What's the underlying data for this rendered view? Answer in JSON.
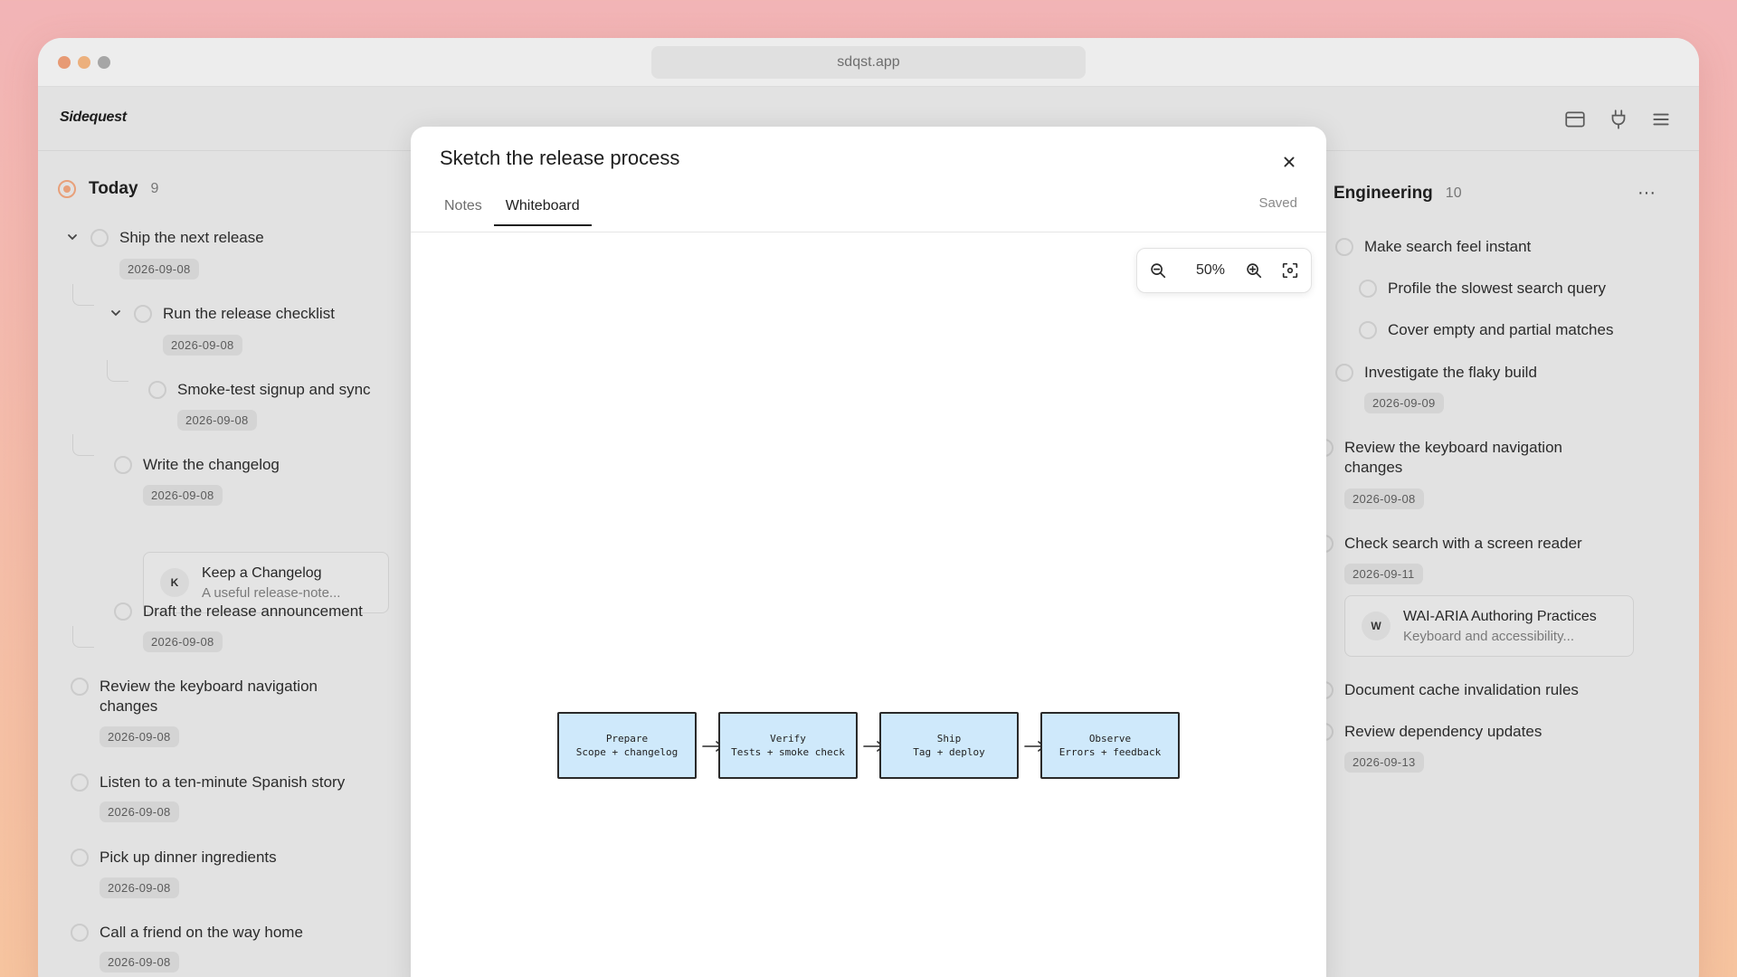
{
  "browser": {
    "url": "sdqst.app"
  },
  "app": {
    "name": "Sidequest"
  },
  "left_column": {
    "title": "Today",
    "count": "9",
    "tasks": [
      {
        "text": "Ship the next release",
        "date": "2026-09-08"
      },
      {
        "text": "Run the release checklist",
        "date": "2026-09-08"
      },
      {
        "text": "Smoke-test signup and sync",
        "date": "2026-09-08"
      },
      {
        "text": "Write the changelog",
        "date": "2026-09-08"
      },
      {
        "text": "Draft the release announcement",
        "date": "2026-09-08"
      },
      {
        "text": "Review the keyboard navigation changes",
        "date": "2026-09-08"
      },
      {
        "text": "Listen to a ten-minute Spanish story",
        "date": "2026-09-08"
      },
      {
        "text": "Pick up dinner ingredients",
        "date": "2026-09-08"
      },
      {
        "text": "Call a friend on the way home",
        "date": "2026-09-08"
      }
    ],
    "link_card": {
      "avatar": "K",
      "title": "Keep a Changelog",
      "subtitle": "A useful release-note..."
    }
  },
  "right_column": {
    "title": "Engineering",
    "count": "10",
    "tasks": [
      {
        "text": "Make search feel instant"
      },
      {
        "text": "Profile the slowest search query"
      },
      {
        "text": "Cover empty and partial matches"
      },
      {
        "text": "Investigate the flaky build",
        "date": "2026-09-09"
      },
      {
        "text": "Review the keyboard navigation changes",
        "date": "2026-09-08"
      },
      {
        "text": "Check search with a screen reader",
        "date": "2026-09-11"
      },
      {
        "text": "Document cache invalidation rules"
      },
      {
        "text": "Review dependency updates",
        "date": "2026-09-13"
      }
    ],
    "link_card": {
      "avatar": "W",
      "title": "WAI-ARIA Authoring Practices",
      "subtitle": "Keyboard and accessibility..."
    }
  },
  "modal": {
    "title": "Sketch the release process",
    "tabs": [
      "Notes",
      "Whiteboard"
    ],
    "active_tab": "Whiteboard",
    "status": "Saved",
    "zoom": "50%",
    "flow": [
      {
        "title": "Prepare",
        "detail": "Scope + changelog"
      },
      {
        "title": "Verify",
        "detail": "Tests + smoke check"
      },
      {
        "title": "Ship",
        "detail": "Tag + deploy"
      },
      {
        "title": "Observe",
        "detail": "Errors + feedback"
      }
    ]
  },
  "icons": {
    "header": [
      "layout-icon",
      "plug-icon",
      "menu-icon"
    ],
    "accent": "#e8a07a",
    "flow_box_fill": "#cfe9fb"
  }
}
